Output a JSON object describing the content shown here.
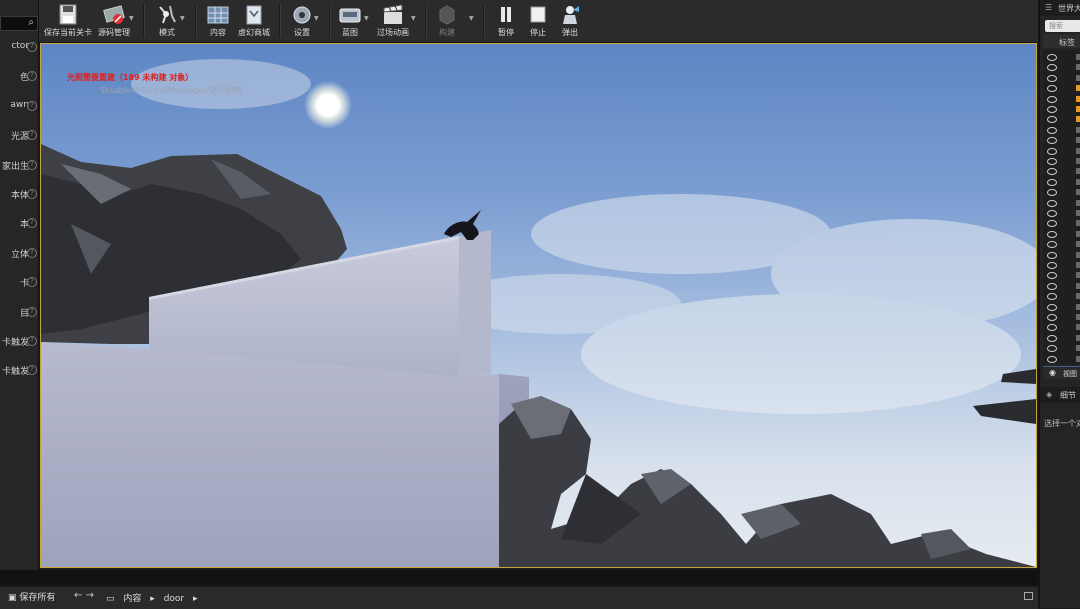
{
  "left_panel": {
    "items": [
      {
        "label": "ctor"
      },
      {
        "label": "色"
      },
      {
        "label": "awn"
      },
      {
        "label": "光源"
      },
      {
        "label": "家出生"
      },
      {
        "label": "本体"
      },
      {
        "label": "本"
      },
      {
        "label": "立体"
      },
      {
        "label": "卡"
      },
      {
        "label": "目"
      },
      {
        "label": "卡触发"
      },
      {
        "label": "卡触发"
      }
    ]
  },
  "toolbar": {
    "buttons": [
      {
        "label": "保存当前关卡",
        "icon": "save-icon"
      },
      {
        "label": "源码管理",
        "icon": "source-control-icon"
      },
      {
        "label": "模式",
        "icon": "modes-icon"
      },
      {
        "label": "内容",
        "icon": "content-icon"
      },
      {
        "label": "虚幻商城",
        "icon": "marketplace-icon"
      },
      {
        "label": "设置",
        "icon": "settings-icon"
      },
      {
        "label": "蓝图",
        "icon": "blueprint-icon"
      },
      {
        "label": "过场动画",
        "icon": "cinematics-icon"
      },
      {
        "label": "构建",
        "icon": "build-icon"
      },
      {
        "label": "暂停",
        "icon": "pause-icon"
      },
      {
        "label": "停止",
        "icon": "stop-icon"
      },
      {
        "label": "弹出",
        "icon": "eject-icon"
      }
    ]
  },
  "viewport": {
    "warning": "光照需要重建（189 未构建 对象）",
    "note": "'DisableAllScreenMessages'进行抑制"
  },
  "outliner": {
    "tab_title": "世界大",
    "search_placeholder": "搜索",
    "column_header": "标签",
    "footer_label": "视图",
    "row_count": 30
  },
  "details": {
    "tab_title": "细节",
    "hint": "选择一个对"
  },
  "content_bar": {
    "save_all": "保存所有",
    "crumbs": [
      "内容",
      "door"
    ]
  },
  "colors": {
    "accent": "#c8a53a",
    "warning": "#e02020",
    "panel": "#262626",
    "sky_top": "#5e86c4"
  }
}
